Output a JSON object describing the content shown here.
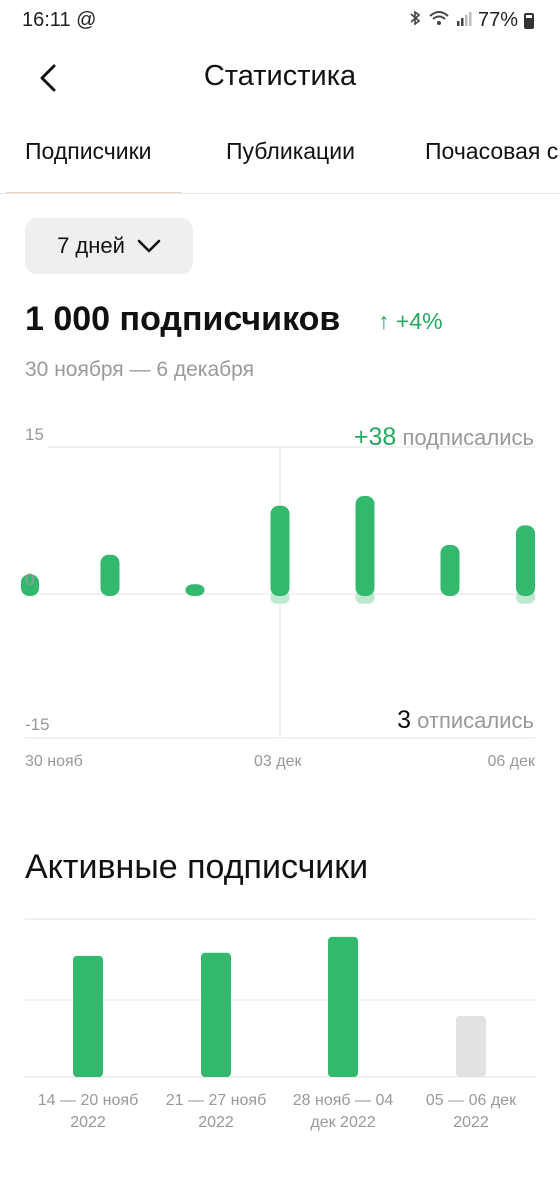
{
  "status_bar": {
    "time": "16:11",
    "at_symbol": "@",
    "battery": "77%",
    "icons": [
      "bluetooth-icon",
      "wifi-icon",
      "signal-icon",
      "battery-icon"
    ]
  },
  "header": {
    "title": "Статистика",
    "back_icon": "chevron-left-icon"
  },
  "tabs": [
    {
      "label": "Подписчики",
      "active": true
    },
    {
      "label": "Публикации",
      "active": false
    },
    {
      "label": "Почасовая с",
      "active": false
    }
  ],
  "period": {
    "label": "7 дней",
    "icon": "chevron-down-icon"
  },
  "summary": {
    "total": "1 000 подписчиков",
    "growth": "↑ +4%",
    "date_range": "30 ноября — 6 декабря"
  },
  "colors": {
    "accent_green": "#33b96e",
    "growth_text": "#28a862",
    "muted_text": "#999999",
    "inactive_bar": "#e2e2e2",
    "tab_underline": "#e8d5c7"
  },
  "chart_data": [
    {
      "type": "bar",
      "categories": [
        "30 нояб",
        "01 дек",
        "02 дек",
        "03 дек",
        "04 дек",
        "05 дек",
        "06 дек"
      ],
      "x_tick_labels": [
        "30 нояб",
        "03 дек",
        "06 дек"
      ],
      "series": [
        {
          "values": [
            2,
            4,
            1,
            9,
            10,
            5,
            7
          ]
        },
        {
          "values": [
            0,
            0,
            0,
            -1,
            -1,
            0,
            -1
          ]
        }
      ],
      "ylim": [
        -15,
        15
      ],
      "y_tick_labels": [
        "15",
        "0",
        "-15"
      ],
      "annotation_top": {
        "value": "+38",
        "label": "подписались"
      },
      "annotation_bottom": {
        "value": "3",
        "label": "отписались"
      },
      "grid": true
    },
    {
      "type": "bar",
      "title": "Активные подписчики",
      "categories": [
        [
          "14 — 20 нояб",
          "2022"
        ],
        [
          "21 — 27 нояб",
          "2022"
        ],
        [
          "28 нояб — 04",
          "дек 2022"
        ],
        [
          "05 — 06 дек",
          "2022"
        ]
      ],
      "values": [
        115,
        118,
        133,
        58
      ],
      "highlighted": [
        true,
        true,
        true,
        false
      ],
      "grid": true
    }
  ]
}
